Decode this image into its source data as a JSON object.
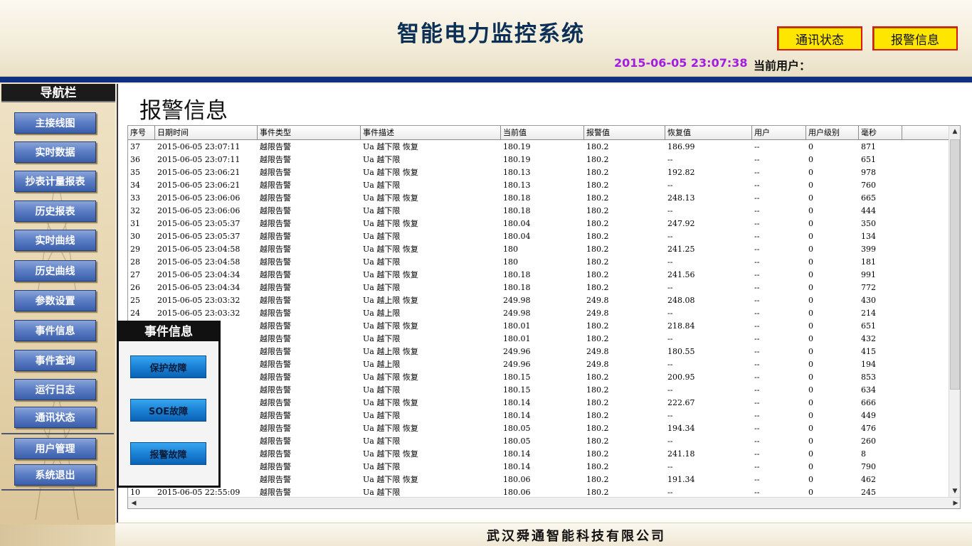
{
  "header": {
    "title": "智能电力监控系统",
    "btn_comm": "通讯状态",
    "btn_alarm": "报警信息",
    "datetime": "2015-06-05 23:07:38",
    "user_label": "当前用户："
  },
  "sidebar": {
    "title": "导航栏",
    "items": [
      "主接线图",
      "实时数据",
      "抄表计量报表",
      "历史报表",
      "实时曲线",
      "历史曲线",
      "参数设置",
      "事件信息",
      "事件查询",
      "运行日志",
      "通讯状态"
    ],
    "bottom_items": [
      "用户管理",
      "系统退出"
    ]
  },
  "page": {
    "title": "报警信息"
  },
  "table": {
    "columns": [
      "序号",
      "日期时间",
      "事件类型",
      "事件描述",
      "当前值",
      "报警值",
      "恢复值",
      "用户",
      "用户级别",
      "毫秒"
    ],
    "rows": [
      [
        "37",
        "2015-06-05 23:07:11",
        "越限告警",
        "Ua 越下限 恢复",
        "180.19",
        "180.2",
        "186.99",
        "--",
        "0",
        "871"
      ],
      [
        "36",
        "2015-06-05 23:07:11",
        "越限告警",
        "Ua 越下限",
        "180.19",
        "180.2",
        "--",
        "--",
        "0",
        "651"
      ],
      [
        "35",
        "2015-06-05 23:06:21",
        "越限告警",
        "Ua 越下限 恢复",
        "180.13",
        "180.2",
        "192.82",
        "--",
        "0",
        "978"
      ],
      [
        "34",
        "2015-06-05 23:06:21",
        "越限告警",
        "Ua 越下限",
        "180.13",
        "180.2",
        "--",
        "--",
        "0",
        "760"
      ],
      [
        "33",
        "2015-06-05 23:06:06",
        "越限告警",
        "Ua 越下限 恢复",
        "180.18",
        "180.2",
        "248.13",
        "--",
        "0",
        "665"
      ],
      [
        "32",
        "2015-06-05 23:06:06",
        "越限告警",
        "Ua 越下限",
        "180.18",
        "180.2",
        "--",
        "--",
        "0",
        "444"
      ],
      [
        "31",
        "2015-06-05 23:05:37",
        "越限告警",
        "Ua 越下限 恢复",
        "180.04",
        "180.2",
        "247.92",
        "--",
        "0",
        "350"
      ],
      [
        "30",
        "2015-06-05 23:05:37",
        "越限告警",
        "Ua 越下限",
        "180.04",
        "180.2",
        "--",
        "--",
        "0",
        "134"
      ],
      [
        "29",
        "2015-06-05 23:04:58",
        "越限告警",
        "Ua 越下限 恢复",
        "180",
        "180.2",
        "241.25",
        "--",
        "0",
        "399"
      ],
      [
        "28",
        "2015-06-05 23:04:58",
        "越限告警",
        "Ua 越下限",
        "180",
        "180.2",
        "--",
        "--",
        "0",
        "181"
      ],
      [
        "27",
        "2015-06-05 23:04:34",
        "越限告警",
        "Ua 越下限 恢复",
        "180.18",
        "180.2",
        "241.56",
        "--",
        "0",
        "991"
      ],
      [
        "26",
        "2015-06-05 23:04:34",
        "越限告警",
        "Ua 越下限",
        "180.18",
        "180.2",
        "--",
        "--",
        "0",
        "772"
      ],
      [
        "25",
        "2015-06-05 23:03:32",
        "越限告警",
        "Ua 越上限 恢复",
        "249.98",
        "249.8",
        "248.08",
        "--",
        "0",
        "430"
      ],
      [
        "24",
        "2015-06-05 23:03:32",
        "越限告警",
        "Ua 越上限",
        "249.98",
        "249.8",
        "--",
        "--",
        "0",
        "214"
      ],
      [
        "",
        "7",
        "越限告警",
        "Ua 越下限 恢复",
        "180.01",
        "180.2",
        "218.84",
        "--",
        "0",
        "651"
      ],
      [
        "",
        "7",
        "越限告警",
        "Ua 越下限",
        "180.01",
        "180.2",
        "--",
        "--",
        "0",
        "432"
      ],
      [
        "",
        "7",
        "越限告警",
        "Ua 越上限 恢复",
        "249.96",
        "249.8",
        "180.55",
        "--",
        "0",
        "415"
      ],
      [
        "",
        "7",
        "越限告警",
        "Ua 越上限",
        "249.96",
        "249.8",
        "--",
        "--",
        "0",
        "194"
      ],
      [
        "",
        "0",
        "越限告警",
        "Ua 越下限 恢复",
        "180.15",
        "180.2",
        "200.95",
        "--",
        "0",
        "853"
      ],
      [
        "",
        "0",
        "越限告警",
        "Ua 越下限",
        "180.15",
        "180.2",
        "--",
        "--",
        "0",
        "634"
      ],
      [
        "",
        "1",
        "越限告警",
        "Ua 越下限 恢复",
        "180.14",
        "180.2",
        "222.67",
        "--",
        "0",
        "666"
      ],
      [
        "",
        "1",
        "越限告警",
        "Ua 越下限",
        "180.14",
        "180.2",
        "--",
        "--",
        "0",
        "449"
      ],
      [
        "",
        "9",
        "越限告警",
        "Ua 越下限 恢复",
        "180.05",
        "180.2",
        "194.34",
        "--",
        "0",
        "476"
      ],
      [
        "",
        "9",
        "越限告警",
        "Ua 越下限",
        "180.05",
        "180.2",
        "--",
        "--",
        "0",
        "260"
      ],
      [
        "",
        "7",
        "越限告警",
        "Ua 越下限 恢复",
        "180.14",
        "180.2",
        "241.18",
        "--",
        "0",
        "8"
      ],
      [
        "",
        "6",
        "越限告警",
        "Ua 越下限",
        "180.14",
        "180.2",
        "--",
        "--",
        "0",
        "790"
      ],
      [
        "",
        "9",
        "越限告警",
        "Ua 越下限 恢复",
        "180.06",
        "180.2",
        "191.34",
        "--",
        "0",
        "462"
      ],
      [
        "10",
        "2015-06-05 22:55:09",
        "越限告警",
        "Ua 越下限",
        "180.06",
        "180.2",
        "--",
        "--",
        "0",
        "245"
      ]
    ]
  },
  "event_panel": {
    "title": "事件信息",
    "buttons": [
      "保护故障",
      "SOE故障",
      "报警故障"
    ]
  },
  "footer": {
    "company": "武汉舜通智能科技有限公司"
  }
}
